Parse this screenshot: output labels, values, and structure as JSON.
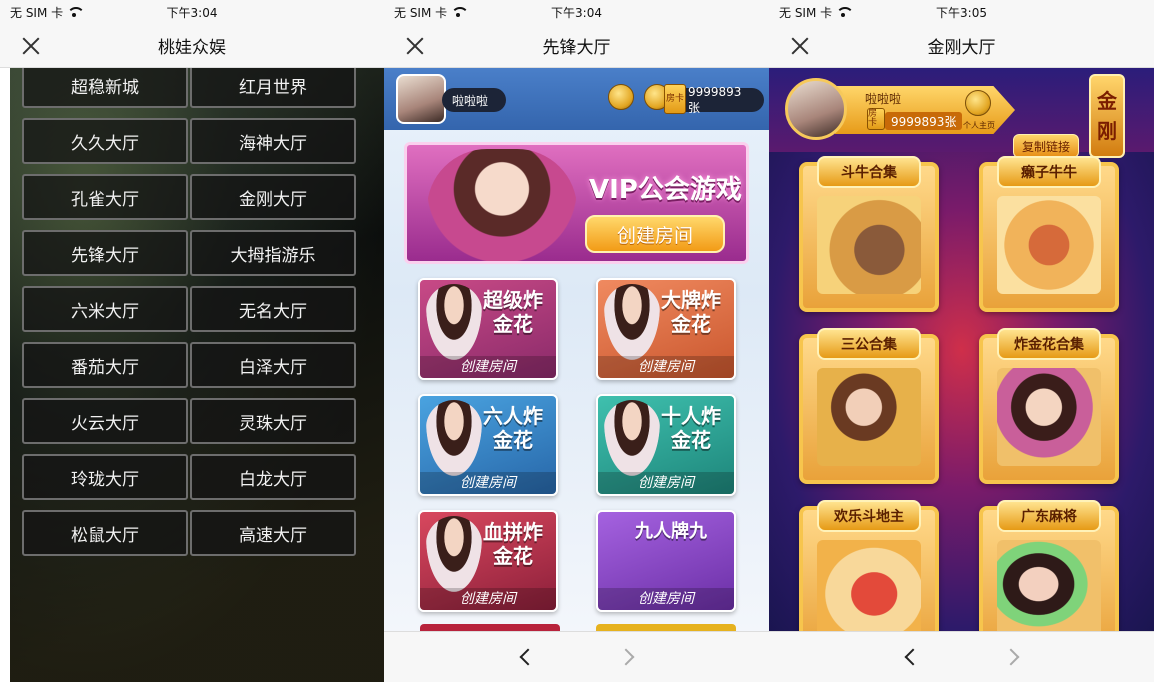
{
  "screens": [
    {
      "status": {
        "carrier": "无 SIM 卡",
        "time": "下午3:04"
      },
      "title": "桃娃众娱",
      "halls": [
        "超稳新城",
        "红月世界",
        "久久大厅",
        "海神大厅",
        "孔雀大厅",
        "金刚大厅",
        "先锋大厅",
        "大拇指游乐",
        "六米大厅",
        "无名大厅",
        "番茄大厅",
        "白泽大厅",
        "火云大厅",
        "灵珠大厅",
        "玲珑大厅",
        "白龙大厅",
        "松鼠大厅",
        "高速大厅"
      ]
    },
    {
      "status": {
        "carrier": "无 SIM 卡",
        "time": "下午3:04"
      },
      "title": "先锋大厅",
      "user": {
        "name": "啦啦啦",
        "cards": "9999893张",
        "card_icon": "房卡"
      },
      "vip": {
        "title": "VIP公会游戏",
        "button": "创建房间"
      },
      "games": [
        {
          "name": "超级炸金花",
          "create": "创建房间"
        },
        {
          "name": "大牌炸金花",
          "create": "创建房间"
        },
        {
          "name": "六人炸金花",
          "create": "创建房间"
        },
        {
          "name": "十人炸金花",
          "create": "创建房间"
        },
        {
          "name": "血拼炸金花",
          "create": "创建房间"
        },
        {
          "name": "九人牌九",
          "create": "创建房间"
        }
      ]
    },
    {
      "status": {
        "carrier": "无 SIM 卡",
        "time": "下午3:05"
      },
      "title": "金刚大厅",
      "user": {
        "name": "啦啦啦",
        "cards": "9999893张",
        "card_icon": "房卡",
        "profile_label": "个人主页"
      },
      "copy_link": "复制链接",
      "badge": [
        "金",
        "刚"
      ],
      "games": [
        "斗牛合集",
        "癞子牛牛",
        "三公合集",
        "炸金花合集",
        "欢乐斗地主",
        "广东麻将"
      ]
    }
  ]
}
